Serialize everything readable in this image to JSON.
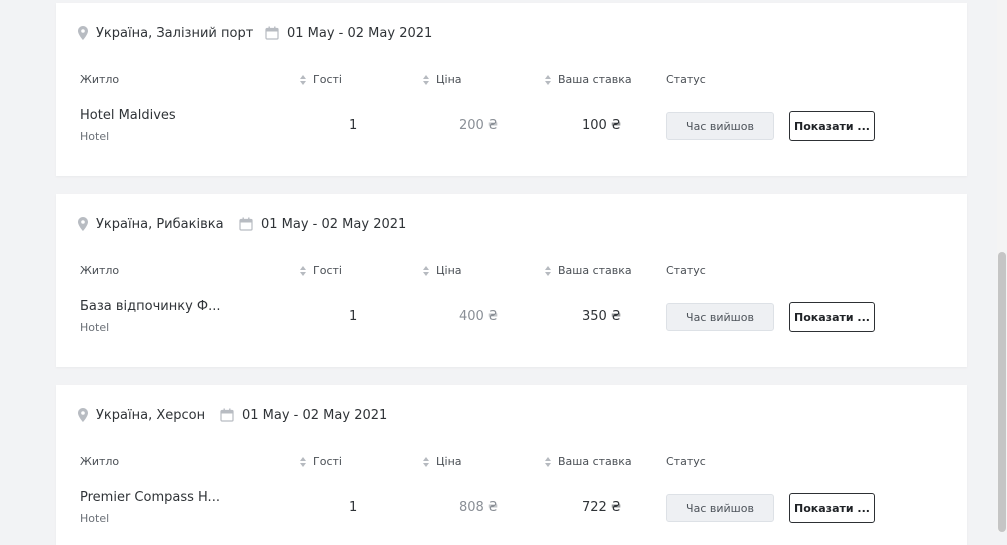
{
  "columns": {
    "housing": "Житло",
    "guests": "Гості",
    "price": "Ціна",
    "bid": "Ваша ставка",
    "status": "Статус"
  },
  "bookings": [
    {
      "location": "Україна, Залізний порт",
      "dates": "01 May - 02 May 2021",
      "name": "Hotel Maldives",
      "type": "Hotel",
      "guests": "1",
      "price": "200 ₴",
      "bid": "100 ₴",
      "status": "Час вийшов",
      "action": "Показати ..."
    },
    {
      "location": "Україна, Рибаківка",
      "dates": "01 May - 02 May 2021",
      "name": "База відпочинку Ф...",
      "type": "Hotel",
      "guests": "1",
      "price": "400 ₴",
      "bid": "350 ₴",
      "status": "Час вийшов",
      "action": "Показати ..."
    },
    {
      "location": "Україна, Херсон",
      "dates": "01 May - 02 May 2021",
      "name": "Premier Compass H...",
      "type": "Hotel",
      "guests": "1",
      "price": "808 ₴",
      "bid": "722 ₴",
      "status": "Час вийшов",
      "action": "Показати ..."
    }
  ],
  "icons": {
    "location": "map-pin-icon",
    "calendar": "calendar-icon",
    "sort": "sort-icon"
  },
  "colors": {
    "background": "#f2f3f5",
    "card": "#ffffff",
    "status_button_bg": "#eef0f3",
    "action_border": "#2d3034",
    "muted_price": "#8a8f96"
  }
}
